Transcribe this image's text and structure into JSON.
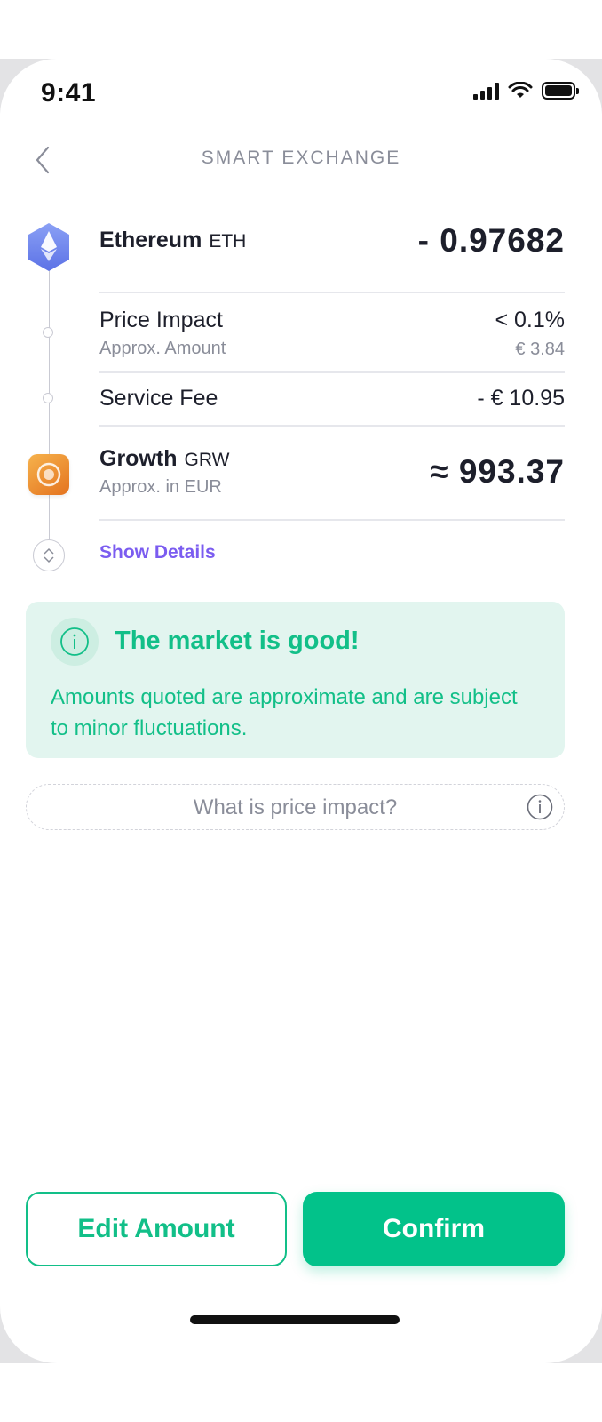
{
  "status_bar": {
    "time": "9:41"
  },
  "header": {
    "title": "SMART EXCHANGE"
  },
  "from_asset": {
    "name": "Ethereum",
    "ticker": "ETH",
    "amount": "- 0.97682"
  },
  "price_impact": {
    "label": "Price Impact",
    "value": "< 0.1%",
    "sublabel": "Approx. Amount",
    "subvalue": "€ 3.84"
  },
  "service_fee": {
    "label": "Service Fee",
    "value": "- € 10.95"
  },
  "to_asset": {
    "name": "Growth",
    "ticker": "GRW",
    "sublabel": "Approx. in EUR",
    "amount": "≈ 993.37"
  },
  "show_details": "Show Details",
  "info_card": {
    "title": "The market is good!",
    "body": "Amounts quoted are approximate and are subject to minor fluctuations."
  },
  "help_link": "What is price impact?",
  "buttons": {
    "edit": "Edit Amount",
    "confirm": "Confirm"
  },
  "colors": {
    "accent_green": "#02c28a",
    "link_purple": "#7b5cf0",
    "eth_blue": "#6f86ee",
    "grw_orange": "#ee8e2f"
  },
  "icons": [
    "back-chevron-icon",
    "signal-icon",
    "wifi-icon",
    "battery-icon",
    "ethereum-icon",
    "growth-coin-icon",
    "expand-details-icon",
    "info-icon"
  ]
}
